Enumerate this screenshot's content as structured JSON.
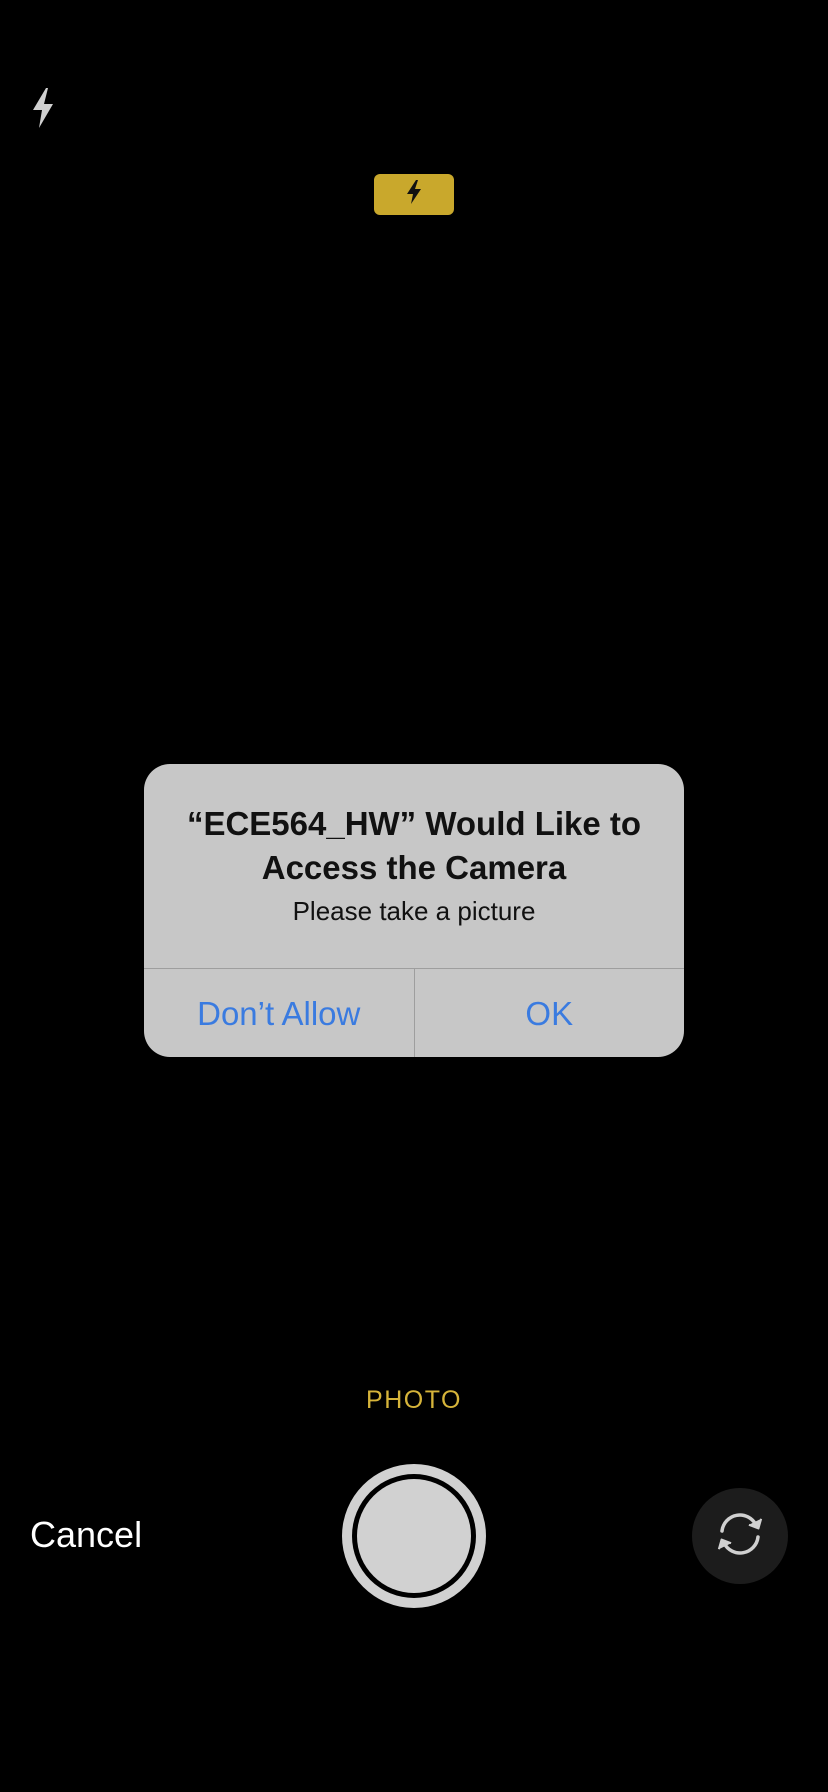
{
  "top_bar": {
    "flash_icon": "lightning-bolt-icon",
    "flash_badge_icon": "lightning-bolt-icon",
    "flash_badge_color": "#c9a82c"
  },
  "alert": {
    "title_line1": "“ECE564_HW” Would Like to",
    "title_line2": "Access the Camera",
    "message": "Please take a picture",
    "deny_label": "Don’t Allow",
    "allow_label": "OK",
    "action_color": "#3a7be0"
  },
  "bottom_bar": {
    "mode_label": "PHOTO",
    "mode_color": "#d6b43a",
    "cancel_label": "Cancel",
    "shutter_icon": "shutter-button",
    "flip_icon": "camera-flip-icon"
  }
}
